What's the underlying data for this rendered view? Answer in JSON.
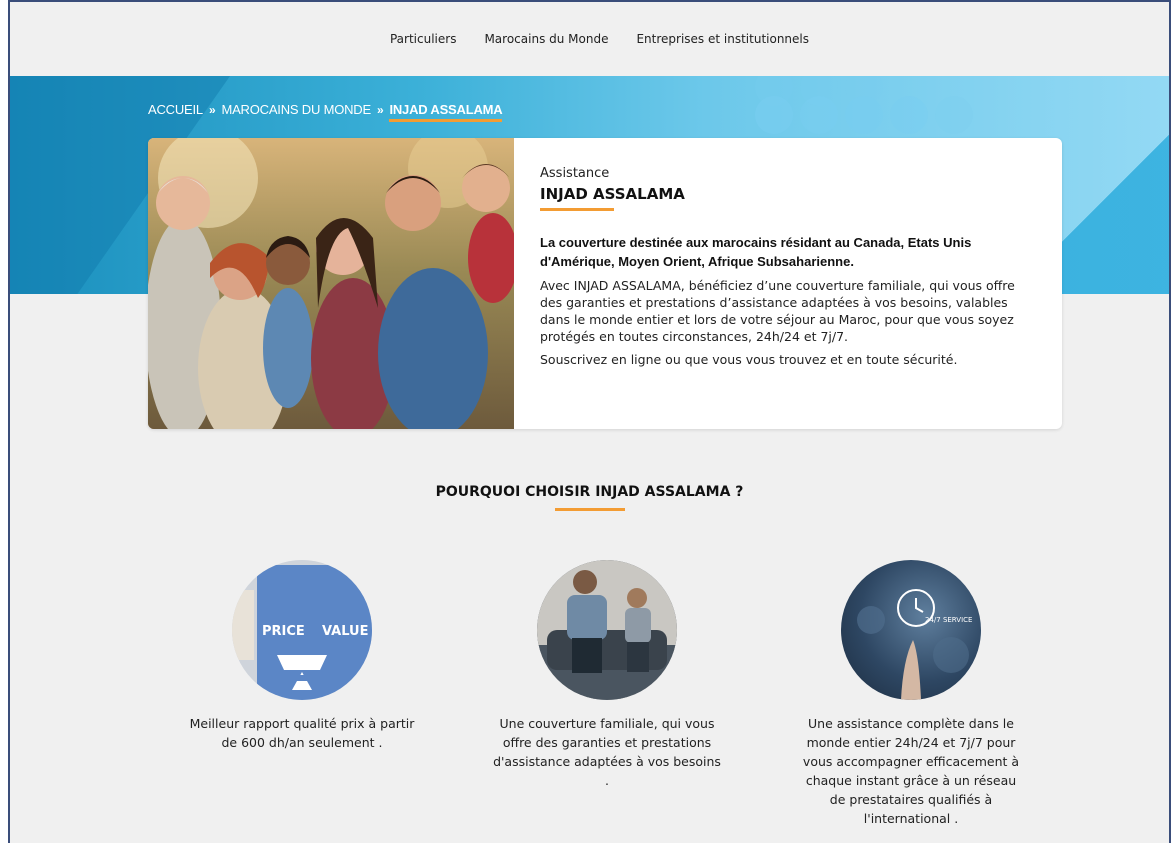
{
  "topnav": {
    "items": [
      "Particuliers",
      "Marocains du Monde",
      "Entreprises et institutionnels"
    ]
  },
  "breadcrumb": {
    "items": [
      "ACCUEIL",
      "MAROCAINS DU MONDE",
      "INJAD ASSALAMA"
    ],
    "separator": "»"
  },
  "hero": {
    "kicker": "Assistance",
    "product": "INJAD ASSALAMA",
    "lead": "La couverture destinée aux marocains résidant au Canada, Etats Unis d'Amérique, Moyen Orient, Afrique Subsaharienne.",
    "paragraph1": "Avec INJAD ASSALAMA, bénéficiez d’une couverture familiale, qui vous offre des garanties et prestations d’assistance adaptées à vos besoins, valables dans le monde entier et lors de votre séjour au Maroc, pour que vous soyez protégés en toutes circonstances, 24h/24 et 7j/7.",
    "paragraph2": "Souscrivez en ligne ou que vous vous trouvez et en toute sécurité."
  },
  "why": {
    "title": "POURQUOI CHOISIR INJAD ASSALAMA ?",
    "features": [
      {
        "icon": "price-value-scale-icon",
        "image_text_left": "PRICE",
        "image_text_right": "VALUE",
        "text": "Meilleur rapport qualité prix à partir de 600 dh/an seulement ."
      },
      {
        "icon": "family-photo-icon",
        "text": "Une couverture familiale, qui vous offre des garanties et prestations d'assistance adaptées à vos besoins ."
      },
      {
        "icon": "service-24-7-icon",
        "image_text": "24/7 SERVICE",
        "text": "Une assistance complète dans le monde entier 24h/24 et 7j/7 pour vous accompagner efficacement à chaque instant grâce à un réseau de prestataires qualifiés à l'international ."
      }
    ]
  },
  "colors": {
    "accent": "#f39c33",
    "banner": "#3bb0d8",
    "background": "#f0f0f0"
  }
}
